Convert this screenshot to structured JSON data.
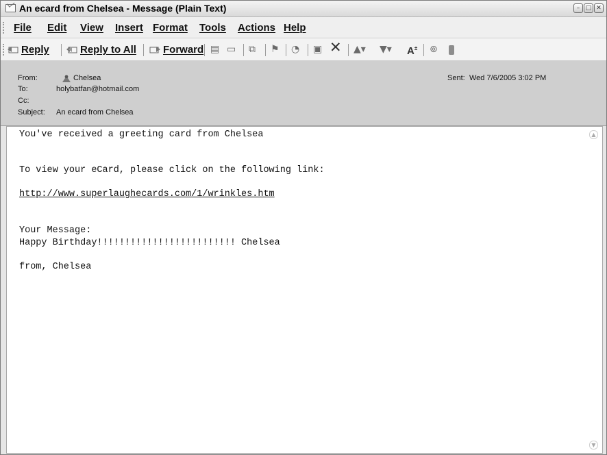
{
  "window": {
    "title": "An ecard from Chelsea - Message (Plain Text)"
  },
  "menu": {
    "items": [
      "File",
      "Edit",
      "View",
      "Insert",
      "Format",
      "Tools",
      "Actions",
      "Help"
    ]
  },
  "toolbar": {
    "reply_label": "Reply",
    "reply_all_label": "Reply to All",
    "forward_label": "Forward",
    "font_size_label": "A",
    "icons": [
      "print-icon",
      "copy-icon",
      "move-to-folder-icon",
      "flag-icon",
      "categorize-icon",
      "address-book-icon",
      "delete-icon",
      "previous-item-icon",
      "next-item-icon",
      "font-size-icon",
      "help-icon"
    ]
  },
  "header": {
    "from_label": "From:",
    "from_value": "Chelsea",
    "to_label": "To:",
    "to_value": "holybatfan@hotmail.com",
    "cc_label": "Cc:",
    "cc_value": "",
    "subject_label": "Subject:",
    "subject_value": "An ecard from Chelsea",
    "sent_label": "Sent:",
    "sent_value": "Wed 7/6/2005 3:02 PM"
  },
  "message": {
    "line1": "You've received a greeting card from Chelsea",
    "line2": "To view your eCard, please click on the following link:",
    "link": "http://www.superlaughecards.com/1/wrinkles.htm",
    "line3": "Your Message:",
    "line4": "Happy Birthday!!!!!!!!!!!!!!!!!!!!!!!!! Chelsea",
    "line5": "from, Chelsea"
  }
}
